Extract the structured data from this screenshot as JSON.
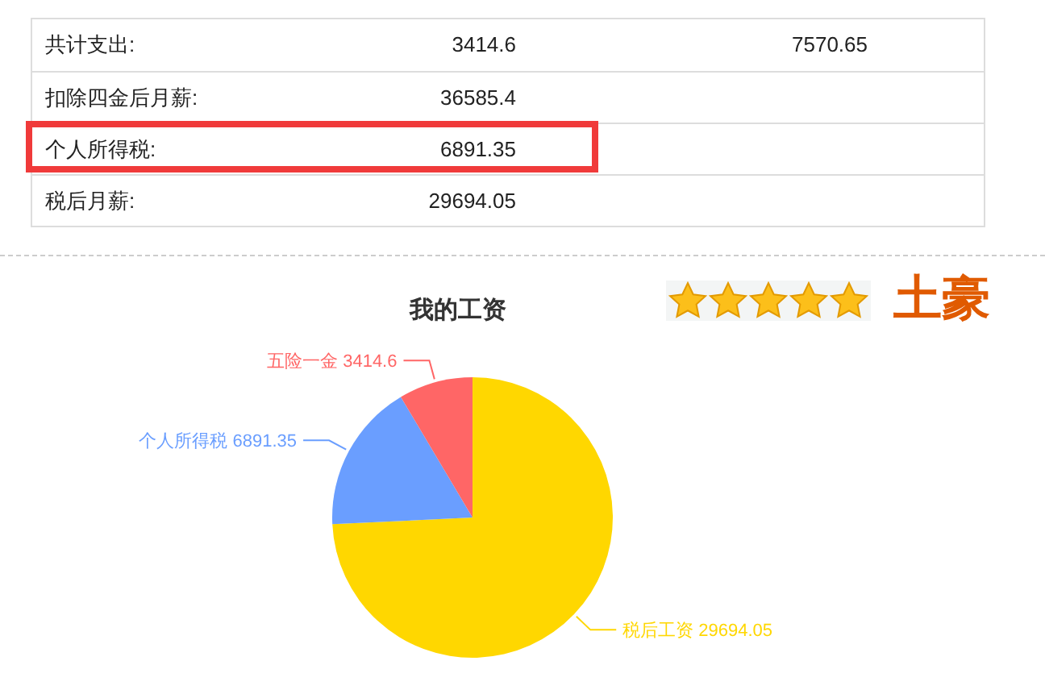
{
  "table": {
    "rows": [
      {
        "label": "共计支出:",
        "value": "3414.6",
        "column_3": "7570.65",
        "highlighted": false
      },
      {
        "label": "扣除四金后月薪:",
        "value": "36585.4",
        "highlighted": false
      },
      {
        "label": "个人所得税:",
        "value": "6891.35",
        "highlighted": true
      },
      {
        "label": "税后月薪:",
        "value": "29694.05",
        "highlighted": false
      }
    ]
  },
  "rating": {
    "stars": 5,
    "label": "土豪"
  },
  "chart": {
    "chart_data": {
      "type": "pie",
      "title": "我的工资",
      "values": [
        29694.05,
        6891.35,
        3414.6
      ],
      "colors": [
        "#ffd700",
        "#6a9eff",
        "#ff6666"
      ],
      "value_labels": [
        "税后工资 29694.05",
        "个人所得税 6891.35",
        "五险一金 3414.6"
      ]
    }
  }
}
